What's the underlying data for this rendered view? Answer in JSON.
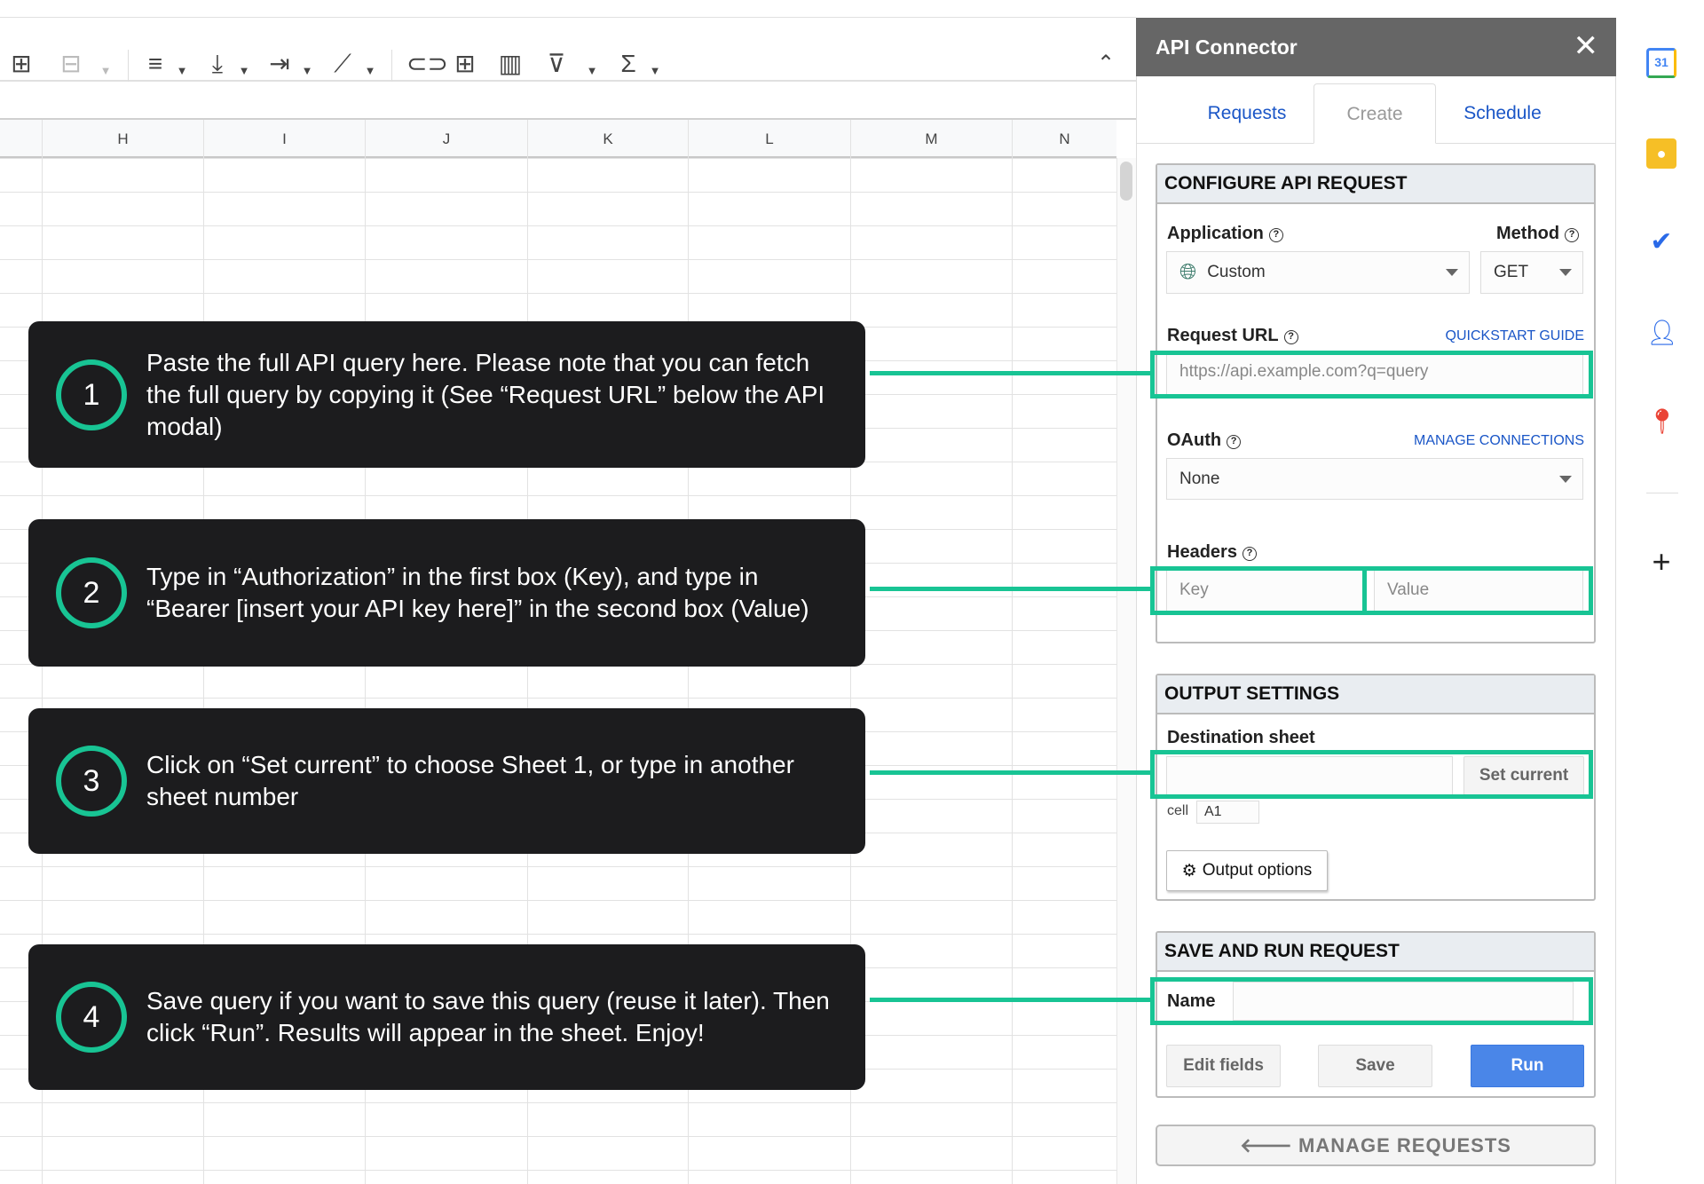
{
  "spreadsheet": {
    "columns": [
      "H",
      "I",
      "J",
      "K",
      "L",
      "M",
      "N"
    ]
  },
  "panel": {
    "title": "API Connector",
    "close_icon": "close-icon",
    "tabs": [
      {
        "label": "Requests",
        "active": false
      },
      {
        "label": "Create",
        "active": true
      },
      {
        "label": "Schedule",
        "active": false
      }
    ],
    "configure": {
      "header": "CONFIGURE API REQUEST",
      "application_label": "Application",
      "application_value": "Custom",
      "method_label": "Method",
      "method_value": "GET",
      "request_url_label": "Request URL",
      "quickstart_link": "QUICKSTART GUIDE",
      "request_url_placeholder": "https://api.example.com?q=query",
      "oauth_label": "OAuth",
      "manage_connections_link": "MANAGE CONNECTIONS",
      "oauth_value": "None",
      "headers_label": "Headers",
      "key_placeholder": "Key",
      "value_placeholder": "Value"
    },
    "output": {
      "header": "OUTPUT SETTINGS",
      "destination_label": "Destination sheet",
      "set_current": "Set current",
      "cell_label": "cell",
      "cell_value": "A1",
      "output_options": "Output options"
    },
    "save_run": {
      "header": "SAVE AND RUN REQUEST",
      "name_label": "Name",
      "edit_fields": "Edit fields",
      "save": "Save",
      "run": "Run"
    },
    "manage_requests": "MANAGE REQUESTS"
  },
  "side_icons": [
    "calendar-icon",
    "keep-icon",
    "tasks-icon",
    "contacts-icon",
    "maps-icon",
    "add-icon"
  ],
  "calendar_day": "31",
  "callouts": [
    {
      "number": "1",
      "text": "Paste the full API query here. Please note that you can fetch the full query by copying it (See “Request URL” below the API modal)"
    },
    {
      "number": "2",
      "text": "Type in “Authorization” in the first box (Key), and type in “Bearer [insert your API key here]” in the second box (Value)"
    },
    {
      "number": "3",
      "text": "Click on “Set current” to choose Sheet 1, or type in another sheet number"
    },
    {
      "number": "4",
      "text": "Save query if you want to save this query (reuse it later). Then click “Run”. Results will appear in the sheet. Enjoy!"
    }
  ],
  "colors": {
    "accent_green": "#18c494",
    "run_blue": "#4a86e8",
    "link_blue": "#1a56c7",
    "panel_header": "#666666",
    "callout_bg": "#1c1c1e"
  }
}
